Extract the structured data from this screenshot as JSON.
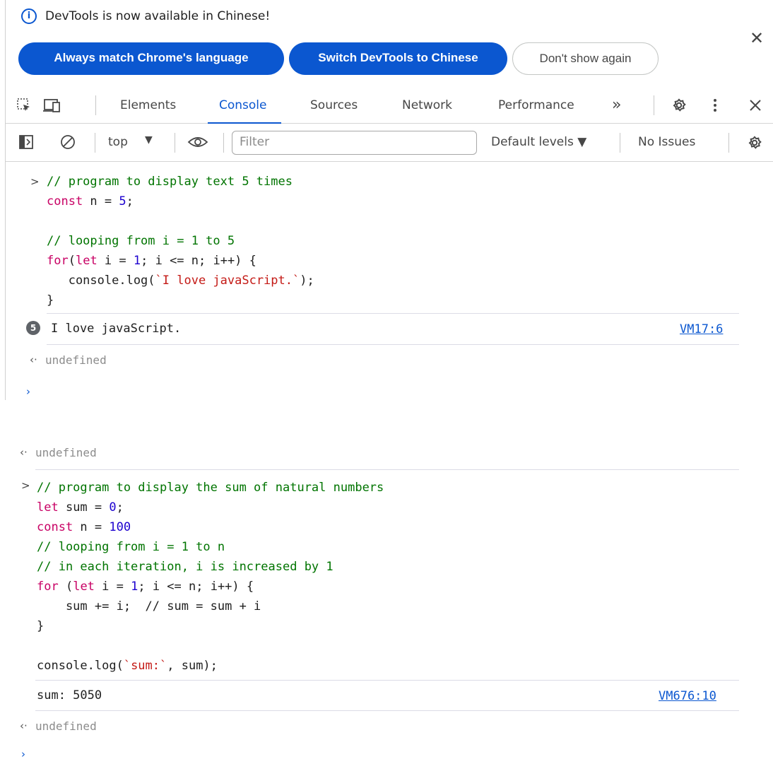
{
  "infobar": {
    "message": "DevTools is now available in Chinese!",
    "btn_match": "Always match Chrome's language",
    "btn_switch": "Switch DevTools to Chinese",
    "btn_dont_show": "Don't show again",
    "close": "✕"
  },
  "tabs": {
    "elements": "Elements",
    "console": "Console",
    "sources": "Sources",
    "network": "Network",
    "performance": "Performance",
    "more": "»"
  },
  "console_toolbar": {
    "context": "top",
    "filter_placeholder": "Filter",
    "levels": "Default levels ▼",
    "issues": "No Issues"
  },
  "block1": {
    "code": [
      [
        [
          "cmt",
          "// program to display text 5 times"
        ]
      ],
      [
        [
          "kw",
          "const"
        ],
        [
          "plain",
          " n = "
        ],
        [
          "num",
          "5"
        ],
        [
          "plain",
          ";"
        ]
      ],
      [],
      [
        [
          "cmt",
          "// looping from i = 1 to 5"
        ]
      ],
      [
        [
          "kw",
          "for"
        ],
        [
          "plain",
          "("
        ],
        [
          "kw",
          "let"
        ],
        [
          "plain",
          " i = "
        ],
        [
          "num",
          "1"
        ],
        [
          "plain",
          "; i <= n; i++) {"
        ]
      ],
      [
        [
          "plain",
          "   console.log("
        ],
        [
          "str",
          "`I love javaScript.`"
        ],
        [
          "plain",
          ");"
        ]
      ],
      [
        [
          "plain",
          "}"
        ]
      ]
    ],
    "log_count": "5",
    "log_text": "I love javaScript.",
    "log_source": "VM17:6",
    "return_value": "undefined"
  },
  "block2": {
    "return_value_top": "undefined",
    "code": [
      [
        [
          "cmt",
          "// program to display the sum of natural numbers"
        ]
      ],
      [
        [
          "kw",
          "let"
        ],
        [
          "plain",
          " sum = "
        ],
        [
          "num",
          "0"
        ],
        [
          "plain",
          ";"
        ]
      ],
      [
        [
          "kw",
          "const"
        ],
        [
          "plain",
          " n = "
        ],
        [
          "num",
          "100"
        ]
      ],
      [
        [
          "cmt",
          "// looping from i = 1 to n"
        ]
      ],
      [
        [
          "cmt",
          "// in each iteration, i is increased by 1"
        ]
      ],
      [
        [
          "kw",
          "for"
        ],
        [
          "plain",
          " ("
        ],
        [
          "kw",
          "let"
        ],
        [
          "plain",
          " i = "
        ],
        [
          "num",
          "1"
        ],
        [
          "plain",
          "; i <= n; i++) {"
        ]
      ],
      [
        [
          "plain",
          "    sum += i;  // sum = sum + i"
        ]
      ],
      [
        [
          "plain",
          "}"
        ]
      ],
      [],
      [
        [
          "plain",
          "console.log("
        ],
        [
          "str",
          "`sum:`"
        ],
        [
          "plain",
          ", sum);"
        ]
      ]
    ],
    "log_text": "sum: 5050",
    "log_source": "VM676:10",
    "return_value": "undefined"
  }
}
